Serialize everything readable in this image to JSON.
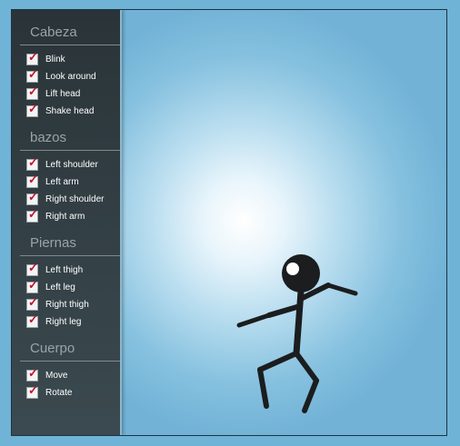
{
  "sidebar": {
    "sections": [
      {
        "title": "Cabeza",
        "items": [
          {
            "label": "Blink",
            "checked": true
          },
          {
            "label": "Look around",
            "checked": true
          },
          {
            "label": "Lift head",
            "checked": true
          },
          {
            "label": "Shake head",
            "checked": true
          }
        ]
      },
      {
        "title": "bazos",
        "items": [
          {
            "label": "Left shoulder",
            "checked": true
          },
          {
            "label": "Left arm",
            "checked": true
          },
          {
            "label": "Right shoulder",
            "checked": true
          },
          {
            "label": "Right arm",
            "checked": true
          }
        ]
      },
      {
        "title": "Piernas",
        "items": [
          {
            "label": "Left thigh",
            "checked": true
          },
          {
            "label": "Left leg",
            "checked": true
          },
          {
            "label": "Right thigh",
            "checked": true
          },
          {
            "label": "Right leg",
            "checked": true
          }
        ]
      },
      {
        "title": "Cuerpo",
        "items": [
          {
            "label": "Move",
            "checked": true
          },
          {
            "label": "Rotate",
            "checked": true
          }
        ]
      }
    ]
  },
  "colors": {
    "check_mark": "#c8102e",
    "sidebar_bg": "#33403f",
    "stage_center": "#ffffff",
    "stage_edge": "#71b2d6",
    "figure": "#1b1d1e"
  }
}
